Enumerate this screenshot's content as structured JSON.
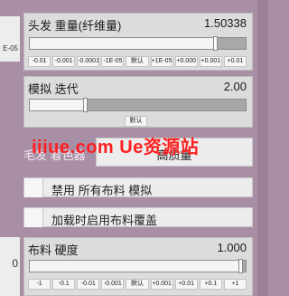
{
  "left_edge": {
    "value_a": "E-05",
    "value_b": "0"
  },
  "hair_weight": {
    "title": "头发 重量(纤维量)",
    "value": "1.50338",
    "slider_fraction": 0.86,
    "steps": [
      "-0.01",
      "-0.001",
      "-0.0001",
      "-1E-05",
      "默认",
      "+1E-05",
      "+0.000",
      "+0.001",
      "+0.01"
    ]
  },
  "sim_iterations": {
    "title": "模拟 迭代",
    "value": "2.00",
    "slider_fraction": 0.26,
    "default_label": "默认"
  },
  "tabs": {
    "hair_shader": "毛发 着色器",
    "high_quality": "高质量"
  },
  "toggles": {
    "disable_cloth_sim": "禁用 所有布料 模拟",
    "enable_cloth_override": "加载时启用布料覆盖"
  },
  "cloth_stiffness": {
    "title": "布料 硬度",
    "value": "1.000",
    "slider_fraction": 0.98,
    "steps": [
      "-1",
      "-0.1",
      "-0.01",
      "-0.001",
      "默认",
      "+0.001",
      "+0.01",
      "+0.1",
      "+1"
    ]
  },
  "watermark": "iiiue.com  Ue资源站",
  "colors": {
    "panel_bg": "#dcdcdc",
    "frame_bg": "#a98fa6",
    "watermark": "#ff1f1f"
  }
}
